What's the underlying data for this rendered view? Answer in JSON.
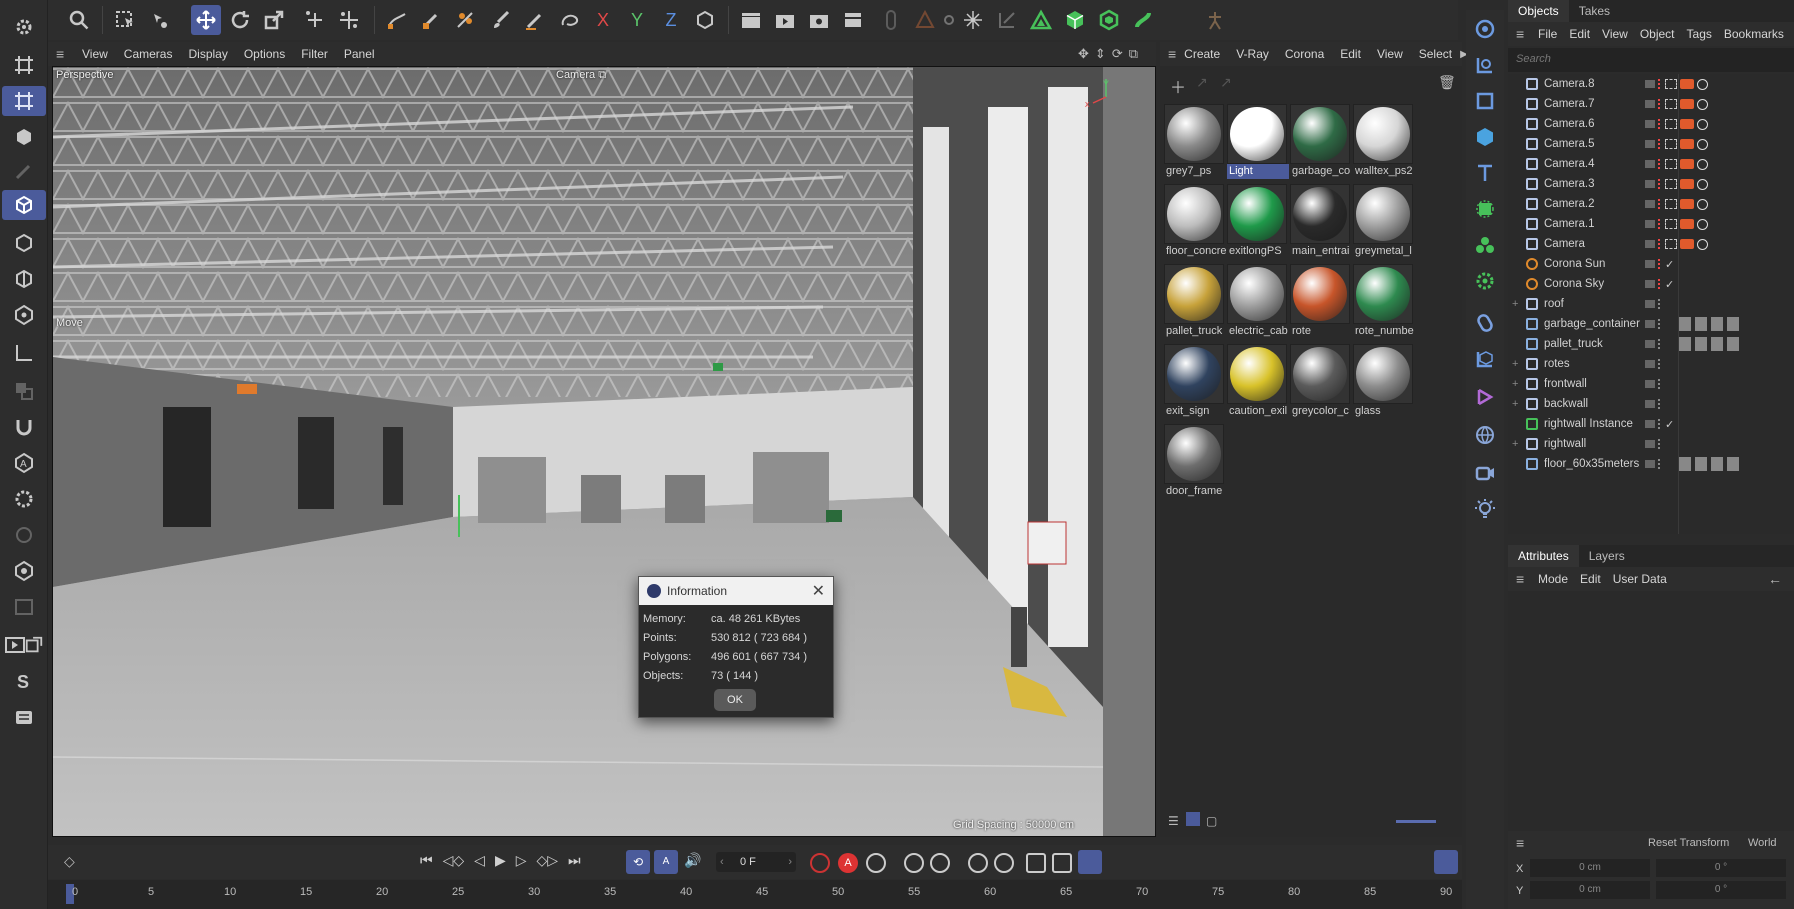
{
  "toolbar": {
    "axis_x": "X",
    "axis_y": "Y",
    "axis_z": "Z"
  },
  "viewport": {
    "menu": [
      "View",
      "Cameras",
      "Display",
      "Options",
      "Filter",
      "Panel"
    ],
    "view_name": "Perspective",
    "camera_label": "Camera",
    "tool_label": "Move",
    "grid_spacing": "Grid Spacing : 50000 cm"
  },
  "materials": {
    "menu": [
      "Create",
      "V-Ray",
      "Corona",
      "Edit",
      "View",
      "Select"
    ],
    "items": [
      {
        "label": "grey7_ps",
        "color": "#8a8a8a"
      },
      {
        "label": "Light",
        "color": "#ffffff"
      },
      {
        "label": "garbage_co",
        "color": "#2f6b46"
      },
      {
        "label": "walltex_ps2",
        "color": "#d6d6d6"
      },
      {
        "label": "floor_concre",
        "color": "#bdbdbd"
      },
      {
        "label": "exitlongPS",
        "color": "#1f9a4a"
      },
      {
        "label": "main_entrai",
        "color": "#2a2a2a"
      },
      {
        "label": "greymetal_l",
        "color": "#a0a0a0"
      },
      {
        "label": "pallet_truck",
        "color": "#c7a23a"
      },
      {
        "label": "electric_cab",
        "color": "#9e9e9e"
      },
      {
        "label": "rote",
        "color": "#c7552a"
      },
      {
        "label": "rote_numbe",
        "color": "#2e8a4f"
      },
      {
        "label": "exit_sign",
        "color": "#30435f"
      },
      {
        "label": "caution_exil",
        "color": "#d8c22a"
      },
      {
        "label": "greycolor_c",
        "color": "#5b5b5b"
      },
      {
        "label": "glass",
        "color": "#8d8d8d"
      },
      {
        "label": "door_frame",
        "color": "#6e6e6e"
      }
    ]
  },
  "objects": {
    "tabs": [
      "Objects",
      "Takes"
    ],
    "menu": [
      "File",
      "Edit",
      "View",
      "Object",
      "Tags",
      "Bookmarks"
    ],
    "search_placeholder": "Search",
    "items": [
      {
        "name": "Camera.8",
        "type": "camera"
      },
      {
        "name": "Camera.7",
        "type": "camera"
      },
      {
        "name": "Camera.6",
        "type": "camera"
      },
      {
        "name": "Camera.5",
        "type": "camera"
      },
      {
        "name": "Camera.4",
        "type": "camera"
      },
      {
        "name": "Camera.3",
        "type": "camera"
      },
      {
        "name": "Camera.2",
        "type": "camera"
      },
      {
        "name": "Camera.1",
        "type": "camera"
      },
      {
        "name": "Camera",
        "type": "camera"
      },
      {
        "name": "Corona Sun",
        "type": "sun"
      },
      {
        "name": "Corona Sky",
        "type": "sky"
      },
      {
        "name": "roof",
        "type": "null"
      },
      {
        "name": "garbage_container",
        "type": "mesh"
      },
      {
        "name": "pallet_truck",
        "type": "mesh"
      },
      {
        "name": "rotes",
        "type": "null"
      },
      {
        "name": "frontwall",
        "type": "null"
      },
      {
        "name": "backwall",
        "type": "null"
      },
      {
        "name": "rightwall Instance",
        "type": "instance"
      },
      {
        "name": "rightwall",
        "type": "null"
      },
      {
        "name": "floor_60x35meters",
        "type": "mesh"
      }
    ]
  },
  "attributes": {
    "tabs": [
      "Attributes",
      "Layers"
    ],
    "menu": [
      "Mode",
      "Edit",
      "User Data"
    ],
    "reset_transform": "Reset Transform",
    "world": "World",
    "rows": [
      {
        "axis": "X",
        "pos": "0 cm",
        "rot": "0 °"
      },
      {
        "axis": "Y",
        "pos": "0 cm",
        "rot": "0 °"
      }
    ]
  },
  "timeline": {
    "current_frame": "0 F",
    "ticks": [
      "0",
      "5",
      "10",
      "15",
      "20",
      "25",
      "30",
      "35",
      "40",
      "45",
      "50",
      "55",
      "60",
      "65",
      "70",
      "75",
      "80",
      "85",
      "90"
    ]
  },
  "dialog": {
    "title": "Information",
    "rows": [
      {
        "label": "Memory:",
        "value": "ca. 48 261 KBytes"
      },
      {
        "label": "Points:",
        "value": "530 812 ( 723 684 )"
      },
      {
        "label": "Polygons:",
        "value": "496 601 ( 667 734 )"
      },
      {
        "label": "Objects:",
        "value": "73 ( 144 )"
      }
    ],
    "ok_label": "OK"
  },
  "colors": {
    "accent": "#4b5b9b",
    "panel": "#2d2d2d",
    "dialog_title_bg": "#f1f1f1"
  }
}
